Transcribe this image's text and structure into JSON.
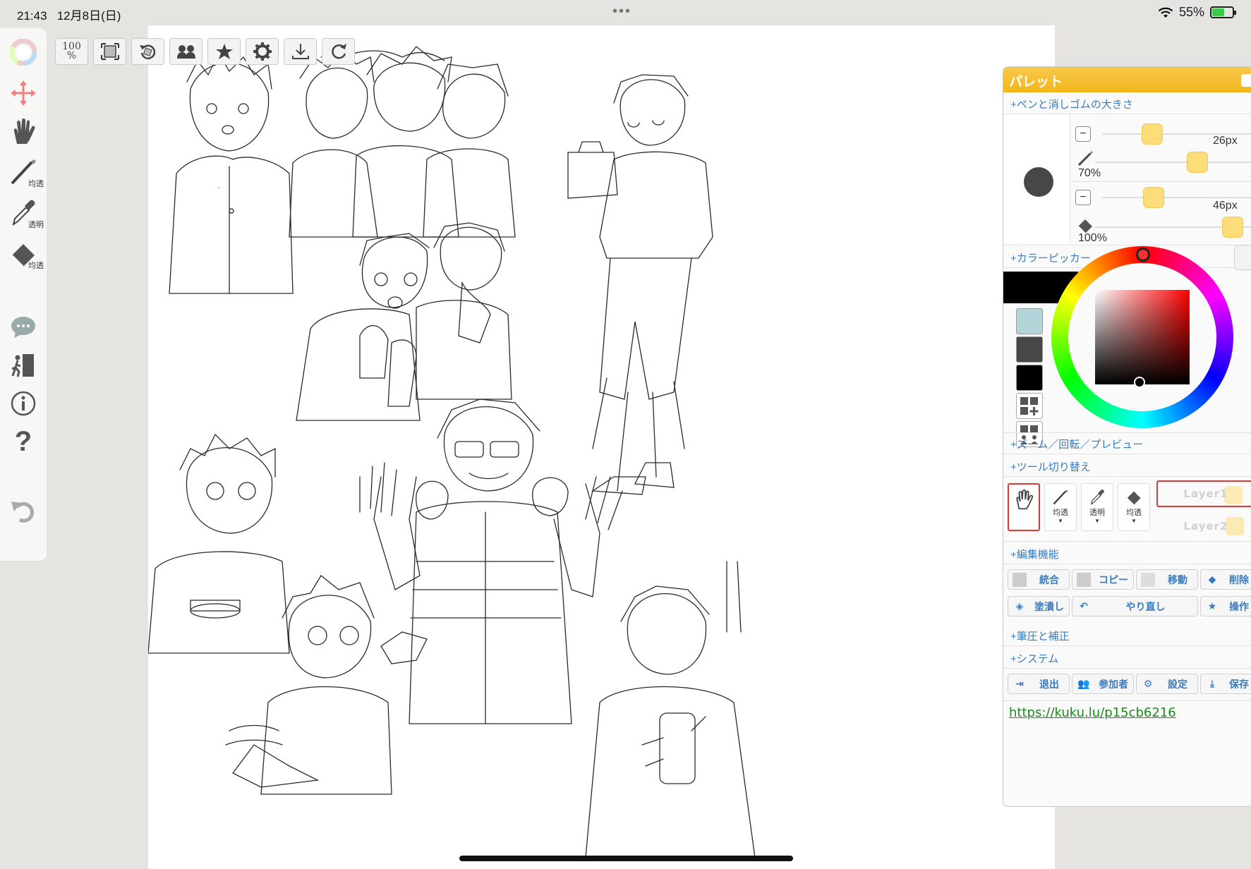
{
  "status": {
    "time": "21:43",
    "date": "12月8日(日)",
    "dots": "•••",
    "battery": "55%"
  },
  "left_tools": [
    {
      "icon": "color-wheel-icon",
      "label": ""
    },
    {
      "icon": "move-arrows-icon",
      "label": ""
    },
    {
      "icon": "hand-icon",
      "label": ""
    },
    {
      "icon": "pen-icon",
      "label": "均透"
    },
    {
      "icon": "eyedropper-icon",
      "label": "透明"
    },
    {
      "icon": "eraser-icon",
      "label": "均透"
    },
    {
      "icon": "chat-icon",
      "label": ""
    },
    {
      "icon": "exit-icon",
      "label": ""
    },
    {
      "icon": "info-icon",
      "label": ""
    },
    {
      "icon": "help-icon",
      "label": "?"
    },
    {
      "icon": "undo-icon",
      "label": ""
    }
  ],
  "top_toolbar": {
    "zoom_top": "100",
    "zoom_bottom": "%"
  },
  "palette": {
    "title": "パレット",
    "sections": {
      "pen_size": "+ペンと消しゴムの大きさ",
      "color_picker": "+カラーピッカー",
      "zoom": "+ズーム／回転／プレビュー",
      "tool_switch": "+ツール切り替え",
      "edit": "+編集機能",
      "pressure": "+筆圧と補正",
      "system": "+システム"
    },
    "pen": {
      "size": "26px",
      "opacity": "70%",
      "size_value": 26,
      "opacity_value": 0.7
    },
    "eraser": {
      "size": "46px",
      "opacity": "100%",
      "size_value": 46,
      "opacity_value": 1.0
    },
    "swatches": [
      "#b3d5da",
      "#474747",
      "#000000"
    ],
    "current_color": "#000000",
    "tool_cells": [
      {
        "icon": "hand-icon",
        "label": ""
      },
      {
        "icon": "pen-icon",
        "label": "均透"
      },
      {
        "icon": "eyedropper-icon",
        "label": "透明"
      },
      {
        "icon": "eraser-icon",
        "label": "均透"
      }
    ],
    "layers": [
      "Layer1",
      "Layer2"
    ],
    "edit_buttons": [
      "統合",
      "コピー",
      "移動",
      "削除",
      "塗潰し",
      "やり直し",
      "操作"
    ],
    "system_buttons": [
      "退出",
      "参加者",
      "設定",
      "保存"
    ],
    "url": "https://kuku.lu/p15cb6216"
  }
}
